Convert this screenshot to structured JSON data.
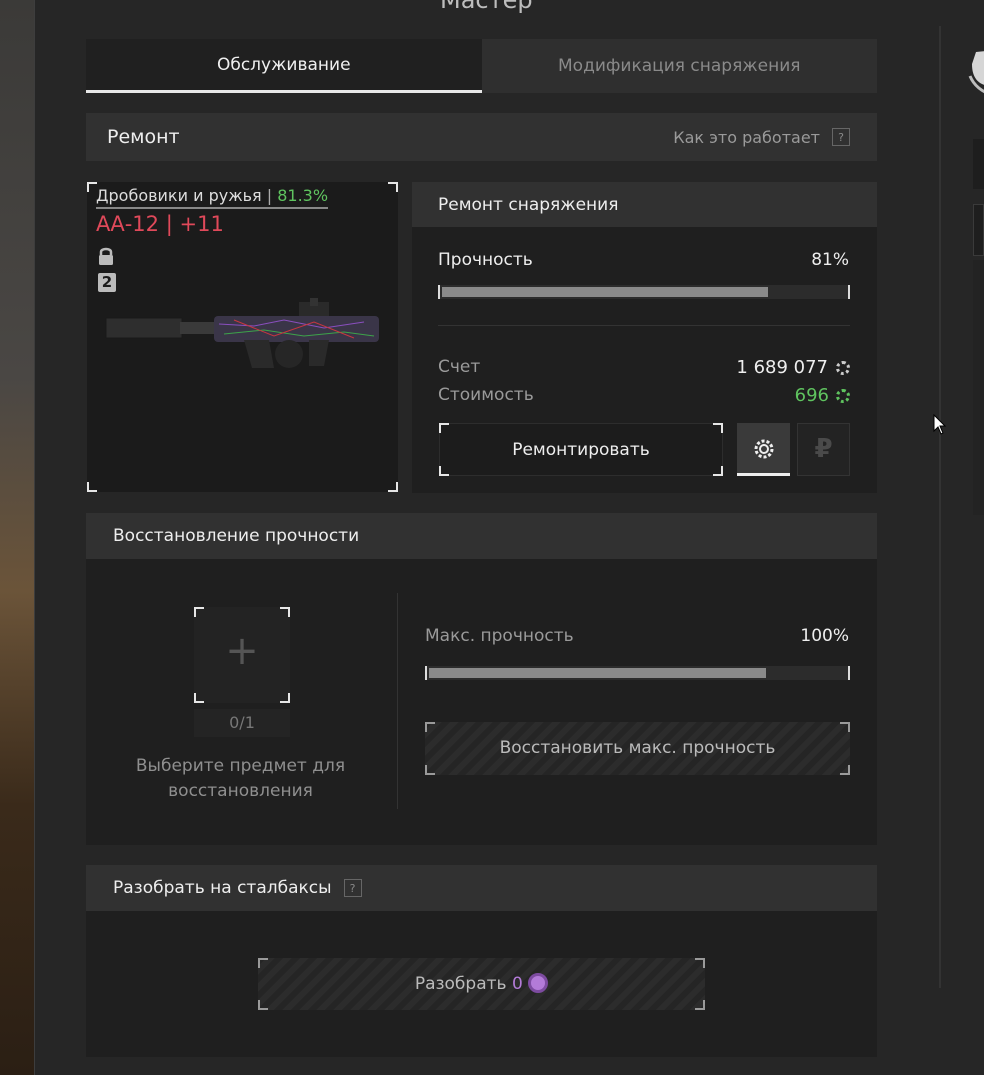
{
  "window": {
    "title": "Мастер"
  },
  "tabs": [
    {
      "label": "Обслуживание",
      "active": true
    },
    {
      "label": "Модификация снаряжения",
      "active": false
    }
  ],
  "repair_section": {
    "title": "Ремонт",
    "help_label": "Как это работает",
    "help_icon": "?",
    "item": {
      "category": "Дробовики и ружья",
      "category_separator": "|",
      "category_percent": "81.3%",
      "name": "АА-12",
      "name_separator": "|",
      "upgrade": "+11",
      "lock_icon": "lock-icon",
      "tier_badge": "2"
    },
    "gear_repair": {
      "title": "Ремонт снаряжения",
      "durability_label": "Прочность",
      "durability_value": "81%",
      "durability_fraction": 0.81,
      "balance_label": "Счет",
      "balance_value": "1 689 077",
      "cost_label": "Стоимость",
      "cost_value": "696",
      "repair_button": "Ремонтировать",
      "currency_gear_icon": "gear-currency-icon",
      "currency_ruble_icon": "₽"
    }
  },
  "restore_section": {
    "title": "Восстановление прочности",
    "slot_plus": "+",
    "slot_count": "0/1",
    "hint": "Выберите предмет для восстановления",
    "max_label": "Макс. прочность",
    "max_value": "100%",
    "max_fraction": 0.81,
    "restore_button": "Восстановить макс. прочность"
  },
  "disassemble_section": {
    "title": "Разобрать на сталбаксы",
    "help_icon": "?",
    "button_label": "Разобрать",
    "button_value": "0"
  },
  "colors": {
    "green": "#5fc35f",
    "red": "#e0495a",
    "purple": "#b37bd8"
  }
}
